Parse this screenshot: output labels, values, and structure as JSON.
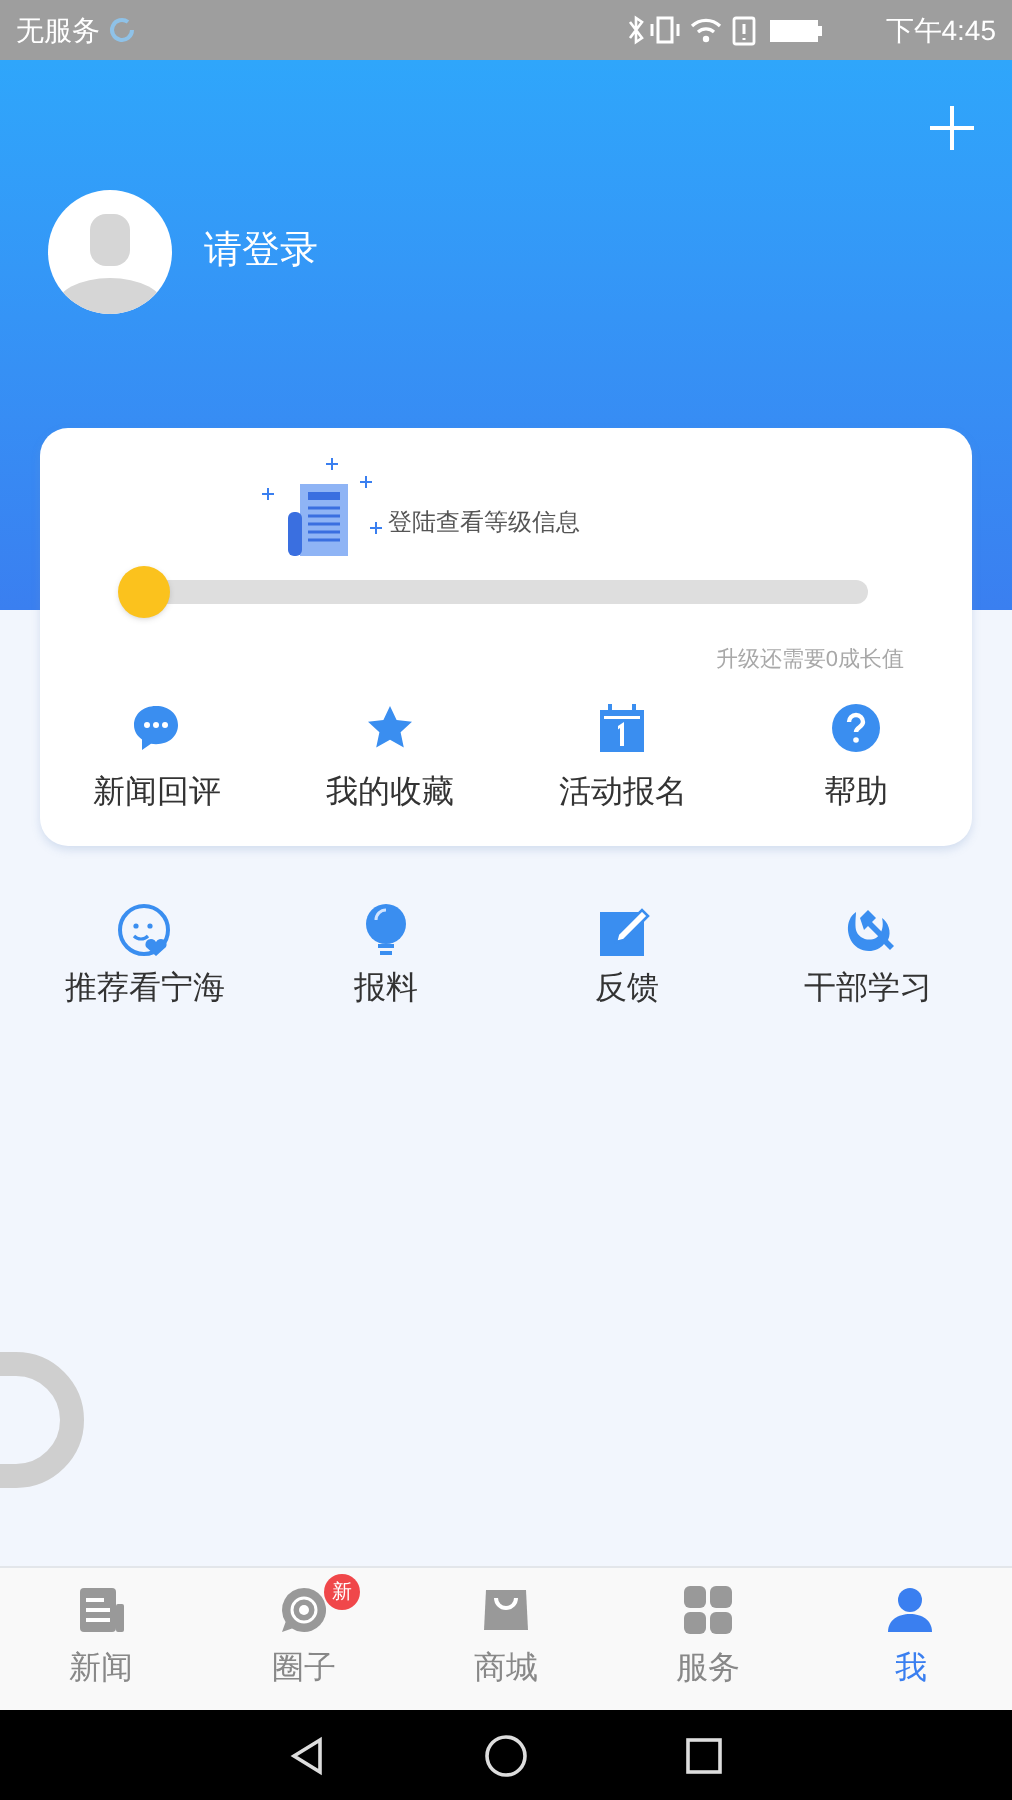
{
  "status_bar": {
    "carrier": "无服务",
    "time": "下午4:45"
  },
  "header": {
    "login_label": "请登录"
  },
  "level_card": {
    "message": "登陆查看等级信息",
    "level": 0,
    "upgrade_hint": "升级还需要0成长值"
  },
  "card_actions": [
    {
      "kind": "comment",
      "label": "新闻回评"
    },
    {
      "kind": "star",
      "label": "我的收藏"
    },
    {
      "kind": "calendar",
      "label": "活动报名"
    },
    {
      "kind": "help",
      "label": "帮助"
    }
  ],
  "shortcuts": [
    {
      "kind": "smile",
      "label": "推荐看宁海"
    },
    {
      "kind": "bulb",
      "label": "报料"
    },
    {
      "kind": "edit",
      "label": "反馈"
    },
    {
      "kind": "party",
      "label": "干部学习"
    }
  ],
  "tab_bar": [
    {
      "kind": "news",
      "label": "新闻",
      "selected": false
    },
    {
      "kind": "circle",
      "label": "圈子",
      "selected": false,
      "badge": "新"
    },
    {
      "kind": "shop",
      "label": "商城",
      "selected": false
    },
    {
      "kind": "service",
      "label": "服务",
      "selected": false
    },
    {
      "kind": "me",
      "label": "我",
      "selected": true
    }
  ]
}
